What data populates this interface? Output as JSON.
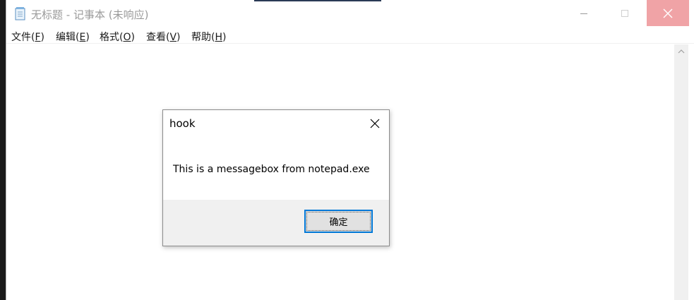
{
  "window": {
    "title": "无标题 - 记事本 (未响应)",
    "icon": "notepad-icon",
    "controls": [
      "minimize-icon",
      "maximize-icon",
      "close-icon"
    ]
  },
  "menu": [
    {
      "label": "文件(",
      "accel": "F",
      "end": ")"
    },
    {
      "label": "编辑(",
      "accel": "E",
      "end": ")"
    },
    {
      "label": "格式(",
      "accel": "O",
      "end": ")"
    },
    {
      "label": "查看(",
      "accel": "V",
      "end": ")"
    },
    {
      "label": "帮助(",
      "accel": "H",
      "end": ")"
    }
  ],
  "dialog": {
    "title": "hook",
    "message": "This is a messagebox from notepad.exe",
    "ok_label": "确定"
  },
  "colors": {
    "close_button_hover": "#f0a3a6",
    "focus_border": "#0078d7",
    "dialog_footer": "#f0f0f0"
  }
}
